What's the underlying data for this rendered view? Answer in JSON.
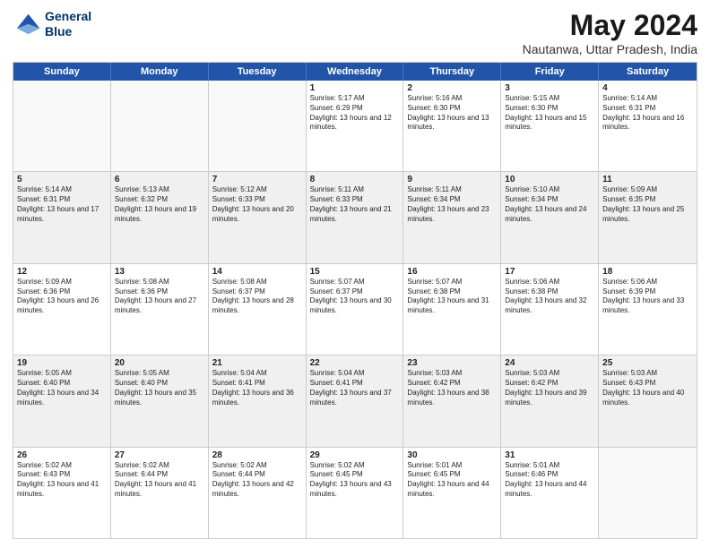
{
  "header": {
    "logo_line1": "General",
    "logo_line2": "Blue",
    "title": "May 2024",
    "subtitle": "Nautanwa, Uttar Pradesh, India"
  },
  "weekdays": [
    "Sunday",
    "Monday",
    "Tuesday",
    "Wednesday",
    "Thursday",
    "Friday",
    "Saturday"
  ],
  "rows": [
    [
      {
        "day": "",
        "empty": true
      },
      {
        "day": "",
        "empty": true
      },
      {
        "day": "",
        "empty": true
      },
      {
        "day": "1",
        "sunrise": "5:17 AM",
        "sunset": "6:29 PM",
        "daylight": "13 hours and 12 minutes."
      },
      {
        "day": "2",
        "sunrise": "5:16 AM",
        "sunset": "6:30 PM",
        "daylight": "13 hours and 13 minutes."
      },
      {
        "day": "3",
        "sunrise": "5:15 AM",
        "sunset": "6:30 PM",
        "daylight": "13 hours and 15 minutes."
      },
      {
        "day": "4",
        "sunrise": "5:14 AM",
        "sunset": "6:31 PM",
        "daylight": "13 hours and 16 minutes."
      }
    ],
    [
      {
        "day": "5",
        "sunrise": "5:14 AM",
        "sunset": "6:31 PM",
        "daylight": "13 hours and 17 minutes."
      },
      {
        "day": "6",
        "sunrise": "5:13 AM",
        "sunset": "6:32 PM",
        "daylight": "13 hours and 19 minutes."
      },
      {
        "day": "7",
        "sunrise": "5:12 AM",
        "sunset": "6:33 PM",
        "daylight": "13 hours and 20 minutes."
      },
      {
        "day": "8",
        "sunrise": "5:11 AM",
        "sunset": "6:33 PM",
        "daylight": "13 hours and 21 minutes."
      },
      {
        "day": "9",
        "sunrise": "5:11 AM",
        "sunset": "6:34 PM",
        "daylight": "13 hours and 23 minutes."
      },
      {
        "day": "10",
        "sunrise": "5:10 AM",
        "sunset": "6:34 PM",
        "daylight": "13 hours and 24 minutes."
      },
      {
        "day": "11",
        "sunrise": "5:09 AM",
        "sunset": "6:35 PM",
        "daylight": "13 hours and 25 minutes."
      }
    ],
    [
      {
        "day": "12",
        "sunrise": "5:09 AM",
        "sunset": "6:36 PM",
        "daylight": "13 hours and 26 minutes."
      },
      {
        "day": "13",
        "sunrise": "5:08 AM",
        "sunset": "6:36 PM",
        "daylight": "13 hours and 27 minutes."
      },
      {
        "day": "14",
        "sunrise": "5:08 AM",
        "sunset": "6:37 PM",
        "daylight": "13 hours and 28 minutes."
      },
      {
        "day": "15",
        "sunrise": "5:07 AM",
        "sunset": "6:37 PM",
        "daylight": "13 hours and 30 minutes."
      },
      {
        "day": "16",
        "sunrise": "5:07 AM",
        "sunset": "6:38 PM",
        "daylight": "13 hours and 31 minutes."
      },
      {
        "day": "17",
        "sunrise": "5:06 AM",
        "sunset": "6:38 PM",
        "daylight": "13 hours and 32 minutes."
      },
      {
        "day": "18",
        "sunrise": "5:06 AM",
        "sunset": "6:39 PM",
        "daylight": "13 hours and 33 minutes."
      }
    ],
    [
      {
        "day": "19",
        "sunrise": "5:05 AM",
        "sunset": "6:40 PM",
        "daylight": "13 hours and 34 minutes."
      },
      {
        "day": "20",
        "sunrise": "5:05 AM",
        "sunset": "6:40 PM",
        "daylight": "13 hours and 35 minutes."
      },
      {
        "day": "21",
        "sunrise": "5:04 AM",
        "sunset": "6:41 PM",
        "daylight": "13 hours and 36 minutes."
      },
      {
        "day": "22",
        "sunrise": "5:04 AM",
        "sunset": "6:41 PM",
        "daylight": "13 hours and 37 minutes."
      },
      {
        "day": "23",
        "sunrise": "5:03 AM",
        "sunset": "6:42 PM",
        "daylight": "13 hours and 38 minutes."
      },
      {
        "day": "24",
        "sunrise": "5:03 AM",
        "sunset": "6:42 PM",
        "daylight": "13 hours and 39 minutes."
      },
      {
        "day": "25",
        "sunrise": "5:03 AM",
        "sunset": "6:43 PM",
        "daylight": "13 hours and 40 minutes."
      }
    ],
    [
      {
        "day": "26",
        "sunrise": "5:02 AM",
        "sunset": "6:43 PM",
        "daylight": "13 hours and 41 minutes."
      },
      {
        "day": "27",
        "sunrise": "5:02 AM",
        "sunset": "6:44 PM",
        "daylight": "13 hours and 41 minutes."
      },
      {
        "day": "28",
        "sunrise": "5:02 AM",
        "sunset": "6:44 PM",
        "daylight": "13 hours and 42 minutes."
      },
      {
        "day": "29",
        "sunrise": "5:02 AM",
        "sunset": "6:45 PM",
        "daylight": "13 hours and 43 minutes."
      },
      {
        "day": "30",
        "sunrise": "5:01 AM",
        "sunset": "6:45 PM",
        "daylight": "13 hours and 44 minutes."
      },
      {
        "day": "31",
        "sunrise": "5:01 AM",
        "sunset": "6:46 PM",
        "daylight": "13 hours and 44 minutes."
      },
      {
        "day": "",
        "empty": true
      }
    ]
  ]
}
